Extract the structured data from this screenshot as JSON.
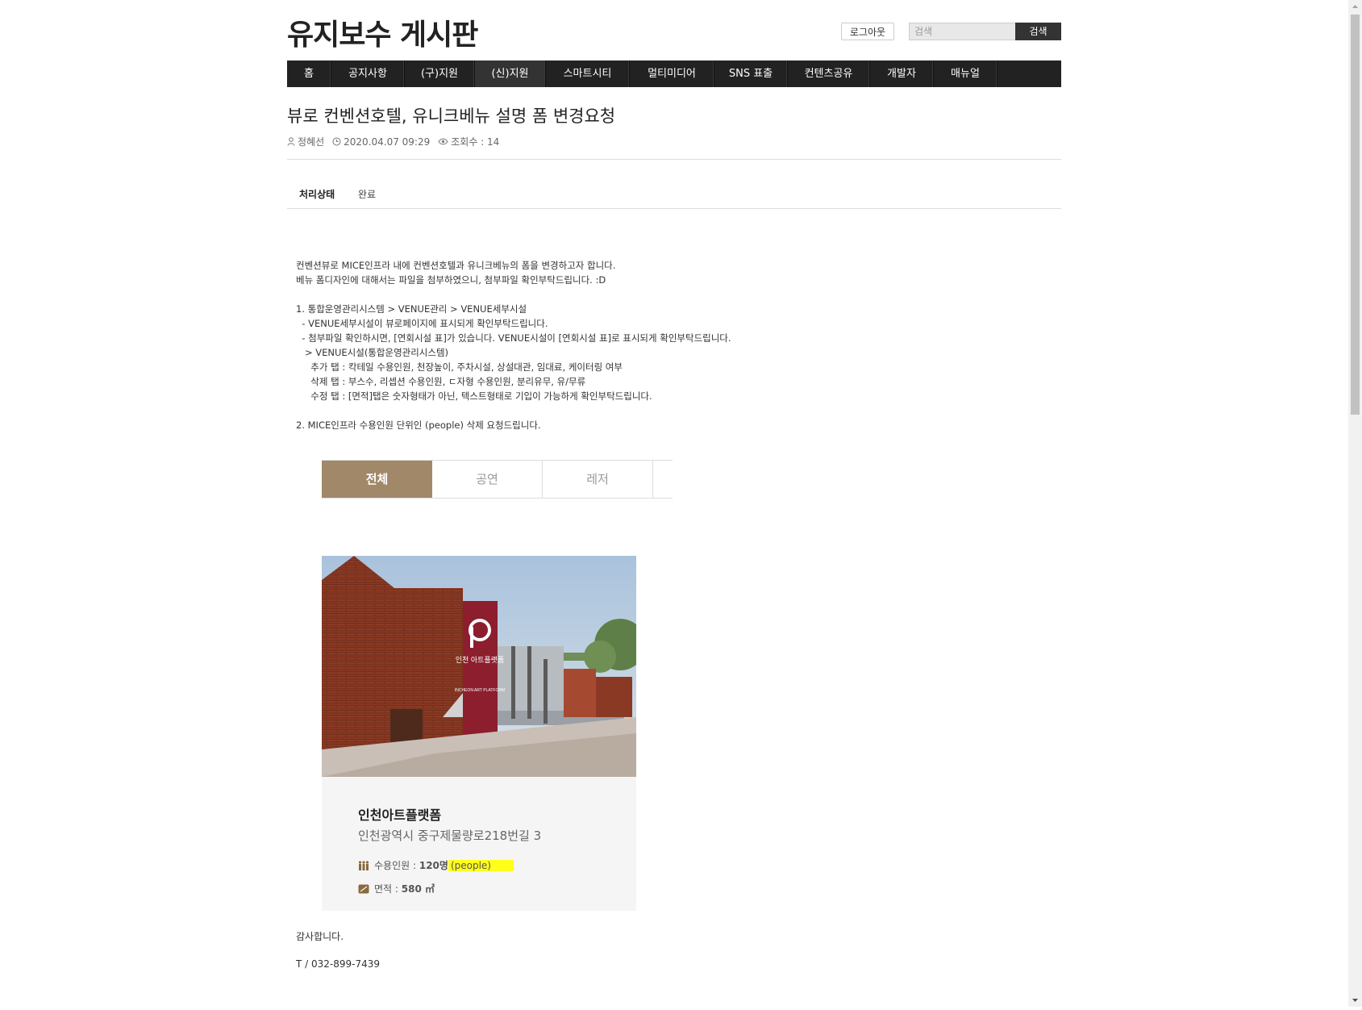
{
  "site_title": "유지보수 게시판",
  "header": {
    "logout_label": "로그아웃",
    "search_placeholder": "검색",
    "search_button": "검색"
  },
  "nav": [
    "홈",
    "공지사항",
    "(구)지원",
    "(신)지원",
    "스마트시티",
    "멀티미디어",
    "SNS 표출",
    "컨텐츠공유",
    "개발자",
    "매뉴얼"
  ],
  "post": {
    "title": "뷰로 컨벤션호텔, 유니크베뉴 설명 폼 변경요청",
    "author": "정혜선",
    "datetime": "2020.04.07 09:29",
    "views": "조회수 : 14",
    "status_label": "처리상태",
    "status_value": "완료",
    "body": "컨벤션뷰로 MICE인프라 내에 컨벤션호텔과 유니크베뉴의 폼을 변경하고자 합니다.\n베뉴 폼디자인에 대해서는 파일을 첨부하였으니, 첨부파일 확인부탁드립니다. :D\n\n1. 통합운영관리시스템 > VENUE관리 > VENUE세부시설\n  - VENUE세부시설이 뷰로페이지에 표시되게 확인부탁드립니다.\n  - 첨부파일 확인하시면, [연회시설 표]가 있습니다. VENUE시설이 [연회시설 표]로 표시되게 확인부탁드립니다.\n   > VENUE시설(통합운영관리시스템)\n     추가 탭 : 칵테일 수용인원, 천장높이, 주차시설, 상설대관, 임대료, 케이터링 여부\n     삭제 탭 : 부스수, 리셉션 수용인원, ㄷ자형 수용인원, 분리유무, 유/무류\n     수정 탭 : [면적]탭은 숫자형태가 아닌, 텍스트형태로 기입이 가능하게 확인부탁드립니다.\n\n2. MICE인프라 수용인원 단위인 (people) 삭제 요청드립니다.",
    "tabs": [
      "전체",
      "공연",
      "레저"
    ],
    "card": {
      "name": "인천아트플랫폼",
      "address": "인천광역시 중구제물량로218번길 3",
      "capacity_label": "수용인원 : ",
      "capacity_value": "120명",
      "capacity_unit": "(people)",
      "area_label": "면적 : ",
      "area_value": "580 ㎡",
      "sign_text": "인천 아트플랫폼",
      "sign_sub": "INCHEON ART PLATFORM"
    },
    "closing": "감사합니다.",
    "phone": "T / 032-899-7439"
  },
  "colors": {
    "nav_bg": "#222222",
    "tab_active": "#a08869",
    "highlight": "#ffff1a",
    "brick": "#8a3a24"
  }
}
